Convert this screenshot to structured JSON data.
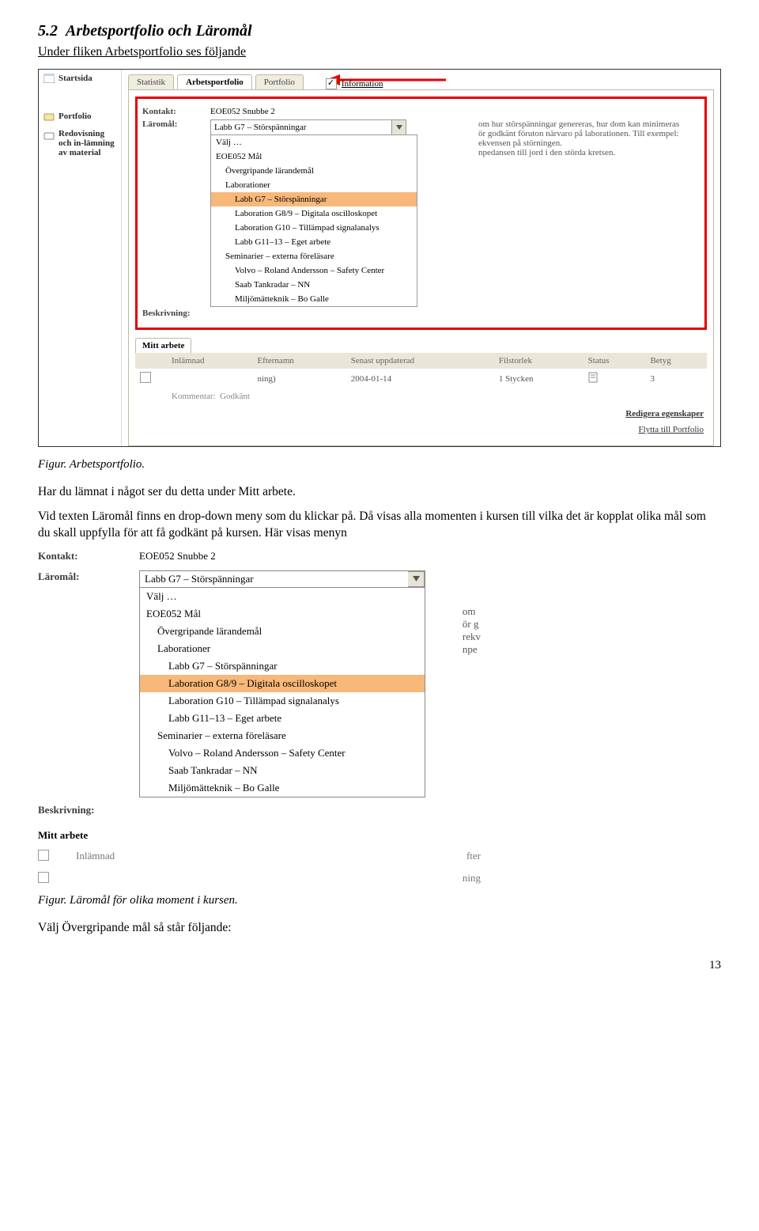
{
  "heading": {
    "number": "5.2",
    "title": "Arbetsportfolio och Läromål",
    "intro": "Under fliken Arbetsportfolio ses följande"
  },
  "sidenav": {
    "home": "Startsida",
    "portfolio": "Portfolio",
    "submit": "Redovisning och in-lämning av material"
  },
  "tabs": {
    "statistik": "Statistik",
    "arbets": "Arbetsportfolio",
    "portfolio": "Portfolio",
    "info": "Information"
  },
  "panel": {
    "kontakt_label": "Kontakt:",
    "kontakt_value": "EOE052 Snubbe 2",
    "laromal_label": "Läromål:",
    "beskriv_label": "Beskrivning:",
    "dropdown_selected": "Labb G7 – Störspänningar",
    "opts": {
      "o0": "Välj …",
      "o1": "EOE052 Mål",
      "o2": "Övergripande lärandemål",
      "o3": "Laborationer",
      "o4": "Labb G7 – Störspänningar",
      "o5": "Laboration G8/9 – Digitala oscilloskopet",
      "o6": "Laboration G10 – Tillämpad signalanalys",
      "o7": "Labb G11–13 – Eget arbete",
      "o8": "Seminarier – externa föreläsare",
      "o9": "Volvo – Roland Andersson – Safety Center",
      "o10": "Saab Tankradar – NN",
      "o11": "Miljömätteknik – Bo Galle"
    },
    "desc_right": "om hur störspänningar genereras, hur dom kan minimeras\nör godkänt föruton närvaro på laborationen. Till exempel:\nekvensen på störningen.\nnpedansen till jord i den störda kretsen."
  },
  "work": {
    "tab": "Mitt arbete",
    "h_check": "",
    "h_inlamn": "Inlämnad",
    "h_efternamn": "Efternamn",
    "h_uppd": "Senast uppdaterad",
    "h_fil": "Filstorlek",
    "h_status": "Status",
    "h_betyg": "Betyg",
    "row_name": "ning)",
    "row_date": "2004-01-14",
    "row_size": "1 Stycken",
    "row_betyg": "3",
    "kommentar": "Kommentar:",
    "kommentar_v": "Godkänt",
    "link1": "Redigera egenskaper",
    "link2": "Flytta till Portfolio"
  },
  "caption1": "Figur. Arbetsportfolio.",
  "mid1": "Har du lämnat i något ser du detta under Mitt arbete.",
  "mid2": "Vid texten Läromål finns en drop-down meny som du klickar på. Då visas alla momenten i kursen till vilka det är kopplat olika mål som du skall uppfylla för att få godkänt på kursen.  Här visas menyn",
  "big": {
    "kontakt_label": "Kontakt:",
    "kontakt_value": "EOE052 Snubbe 2",
    "laromal_label": "Läromål:",
    "beskriv_label": "Beskrivning:",
    "selected": "Labb G7 – Störspänningar",
    "opts": {
      "o0": "Välj …",
      "o1": "EOE052 Mål",
      "o2": "Övergripande lärandemål",
      "o3": "Laborationer",
      "o4": "Labb G7 – Störspänningar",
      "o5": "Laboration G8/9 – Digitala oscilloskopet",
      "o6": "Laboration G10 – Tillämpad signalanalys",
      "o7": "Labb G11–13 – Eget arbete",
      "o8": "Seminarier – externa föreläsare",
      "o9": "Volvo – Roland Andersson – Safety Center",
      "o10": "Saab Tankradar – NN",
      "o11": "Miljömätteknik – Bo Galle"
    },
    "right1": "om",
    "right2": "ör  g",
    "right3": "rekv",
    "right4": "npe",
    "mitt": "Mitt arbete",
    "g1": "Inlämnad",
    "g2": "fter",
    "g3": "ning"
  },
  "caption2": "Figur. Läromål för olika moment i kursen.",
  "closing": "Välj Övergripande mål så står följande:",
  "pagenum": "13"
}
